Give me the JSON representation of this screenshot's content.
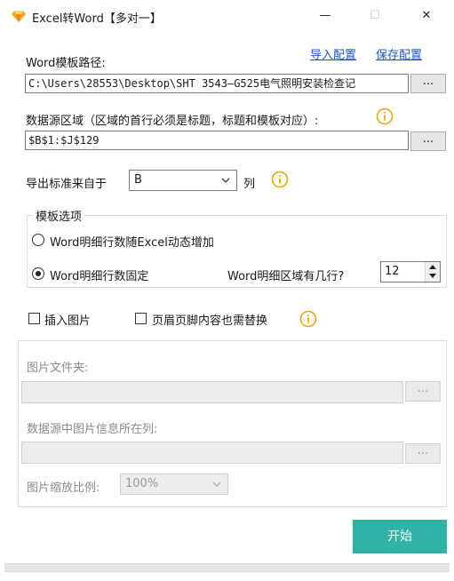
{
  "window": {
    "title": "Excel转Word【多对一】",
    "minimize": "—",
    "maximize": "☐",
    "close": "✕"
  },
  "config_links": {
    "import": "导入配置",
    "save": "保存配置"
  },
  "template": {
    "label": "Word模板路径:",
    "value": "C:\\Users\\28553\\Desktop\\SHT 3543—G525电气照明安装检查记",
    "browse": "..."
  },
  "datasource": {
    "label": "数据源区域（区域的首行必须是标题，标题和模板对应）:",
    "value": "$B$1:$J$129",
    "browse": "..."
  },
  "export_column": {
    "label": "导出标准来自于",
    "selected": "B",
    "suffix": "列"
  },
  "template_options": {
    "title": "模板选项",
    "option_dynamic": "Word明细行数随Excel动态增加",
    "option_fixed": "Word明细行数固定",
    "selected": "fixed",
    "rows_label": "Word明细区域有几行?",
    "rows_value": "12"
  },
  "checks": {
    "insert_picture": {
      "label": "插入图片",
      "checked": false
    },
    "header_footer": {
      "label": "页眉页脚内容也需替换",
      "checked": false
    }
  },
  "picture_panel": {
    "folder_label": "图片文件夹:",
    "folder_value": "",
    "folder_browse": "...",
    "column_label": "数据源中图片信息所在列:",
    "column_value": "",
    "column_browse": "...",
    "scale_label": "图片缩放比例:",
    "scale_value": "100%"
  },
  "start_button": "开始",
  "colors": {
    "accent": "#2fb3a6",
    "info": "#e8a800",
    "link": "#1a56c8"
  }
}
